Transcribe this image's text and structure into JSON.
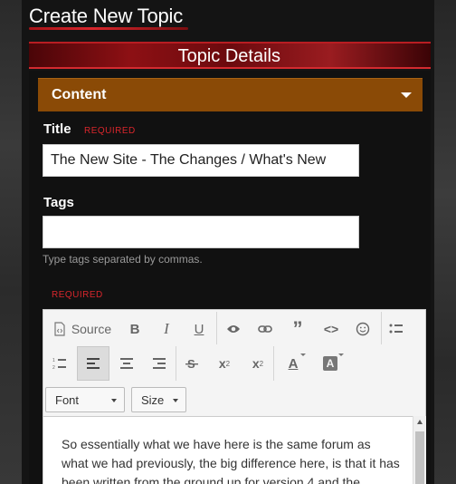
{
  "page": {
    "title": "Create New Topic"
  },
  "banner": {
    "title": "Topic Details"
  },
  "section": {
    "label": "Content"
  },
  "form": {
    "title_label": "Title",
    "title_required": "REQUIRED",
    "title_value": "The New Site - The Changes / What's New",
    "tags_label": "Tags",
    "tags_value": "",
    "tags_hint": "Type tags separated by commas.",
    "content_required": "REQUIRED"
  },
  "editor": {
    "source_label": "Source",
    "bold_label": "B",
    "italic_label": "I",
    "underline_label": "U",
    "quote_label": "”",
    "code_label": "<>",
    "font_label": "Font",
    "size_label": "Size",
    "superscript_base": "x",
    "superscript_mark": "2",
    "subscript_base": "x",
    "subscript_mark": "2",
    "text_color_label": "A",
    "bg_color_label": "A",
    "content_text": "So essentially what we have here is the same forum as what we had previously, the big difference here, is that it has been written from the ground up for version 4 and the"
  }
}
